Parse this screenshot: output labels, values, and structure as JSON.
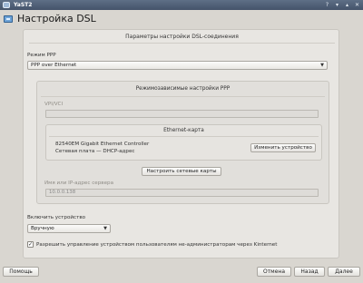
{
  "window": {
    "title": "YaST2"
  },
  "header": {
    "title": "Настройка DSL"
  },
  "main": {
    "section_title": "Параметры настройки DSL-соединения",
    "ppp_mode": {
      "label": "Режим PPP",
      "value": "PPP over Ethernet"
    },
    "mode_group": {
      "title": "Режимозависимые настройки PPP",
      "vpi_label": "VPI/VCI",
      "vpi_value": "",
      "ethernet_group": {
        "title": "Ethernet-карта",
        "card_name": "82540EM Gigabit Ethernet Controller",
        "card_info": "Сетевая плата — DHCP-адрес",
        "change_button": "Изменить устройство"
      },
      "configure_cards_button": "Настроить сетевые карты",
      "server_label": "Имя или IP-адрес сервера",
      "server_value": "10.0.0.138"
    },
    "activate": {
      "label": "Включить устройство",
      "value": "Вручную"
    },
    "allow_users": {
      "label": "Разрешить управление устройством пользователям не-администраторам через Kinternet",
      "checked": true
    }
  },
  "footer": {
    "help": "Помощь",
    "cancel": "Отмена",
    "back": "Назад",
    "next": "Далее"
  }
}
